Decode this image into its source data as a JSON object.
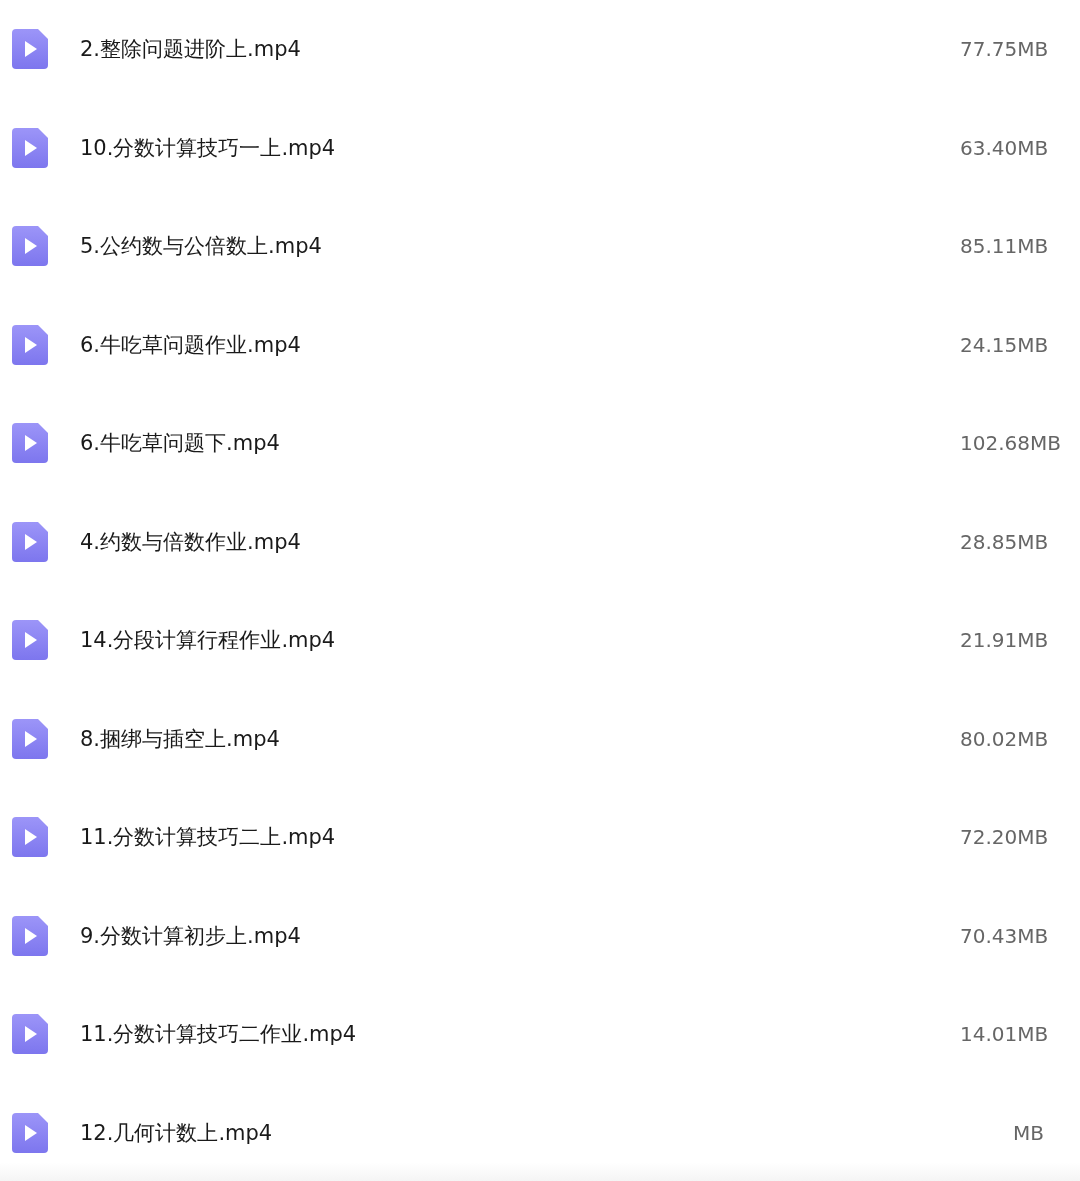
{
  "files": [
    {
      "name": "2.整除问题进阶上.mp4",
      "size": "77.75MB"
    },
    {
      "name": "10.分数计算技巧一上.mp4",
      "size": "63.40MB"
    },
    {
      "name": "5.公约数与公倍数上.mp4",
      "size": "85.11MB"
    },
    {
      "name": "6.牛吃草问题作业.mp4",
      "size": "24.15MB"
    },
    {
      "name": "6.牛吃草问题下.mp4",
      "size": "102.68MB"
    },
    {
      "name": "4.约数与倍数作业.mp4",
      "size": "28.85MB"
    },
    {
      "name": "14.分段计算行程作业.mp4",
      "size": "21.91MB"
    },
    {
      "name": "8.捆绑与插空上.mp4",
      "size": "80.02MB"
    },
    {
      "name": "11.分数计算技巧二上.mp4",
      "size": "72.20MB"
    },
    {
      "name": "9.分数计算初步上.mp4",
      "size": "70.43MB"
    },
    {
      "name": "11.分数计算技巧二作业.mp4",
      "size": "14.01MB"
    },
    {
      "name": "12.几何计数上.mp4",
      "size": "MB"
    }
  ]
}
